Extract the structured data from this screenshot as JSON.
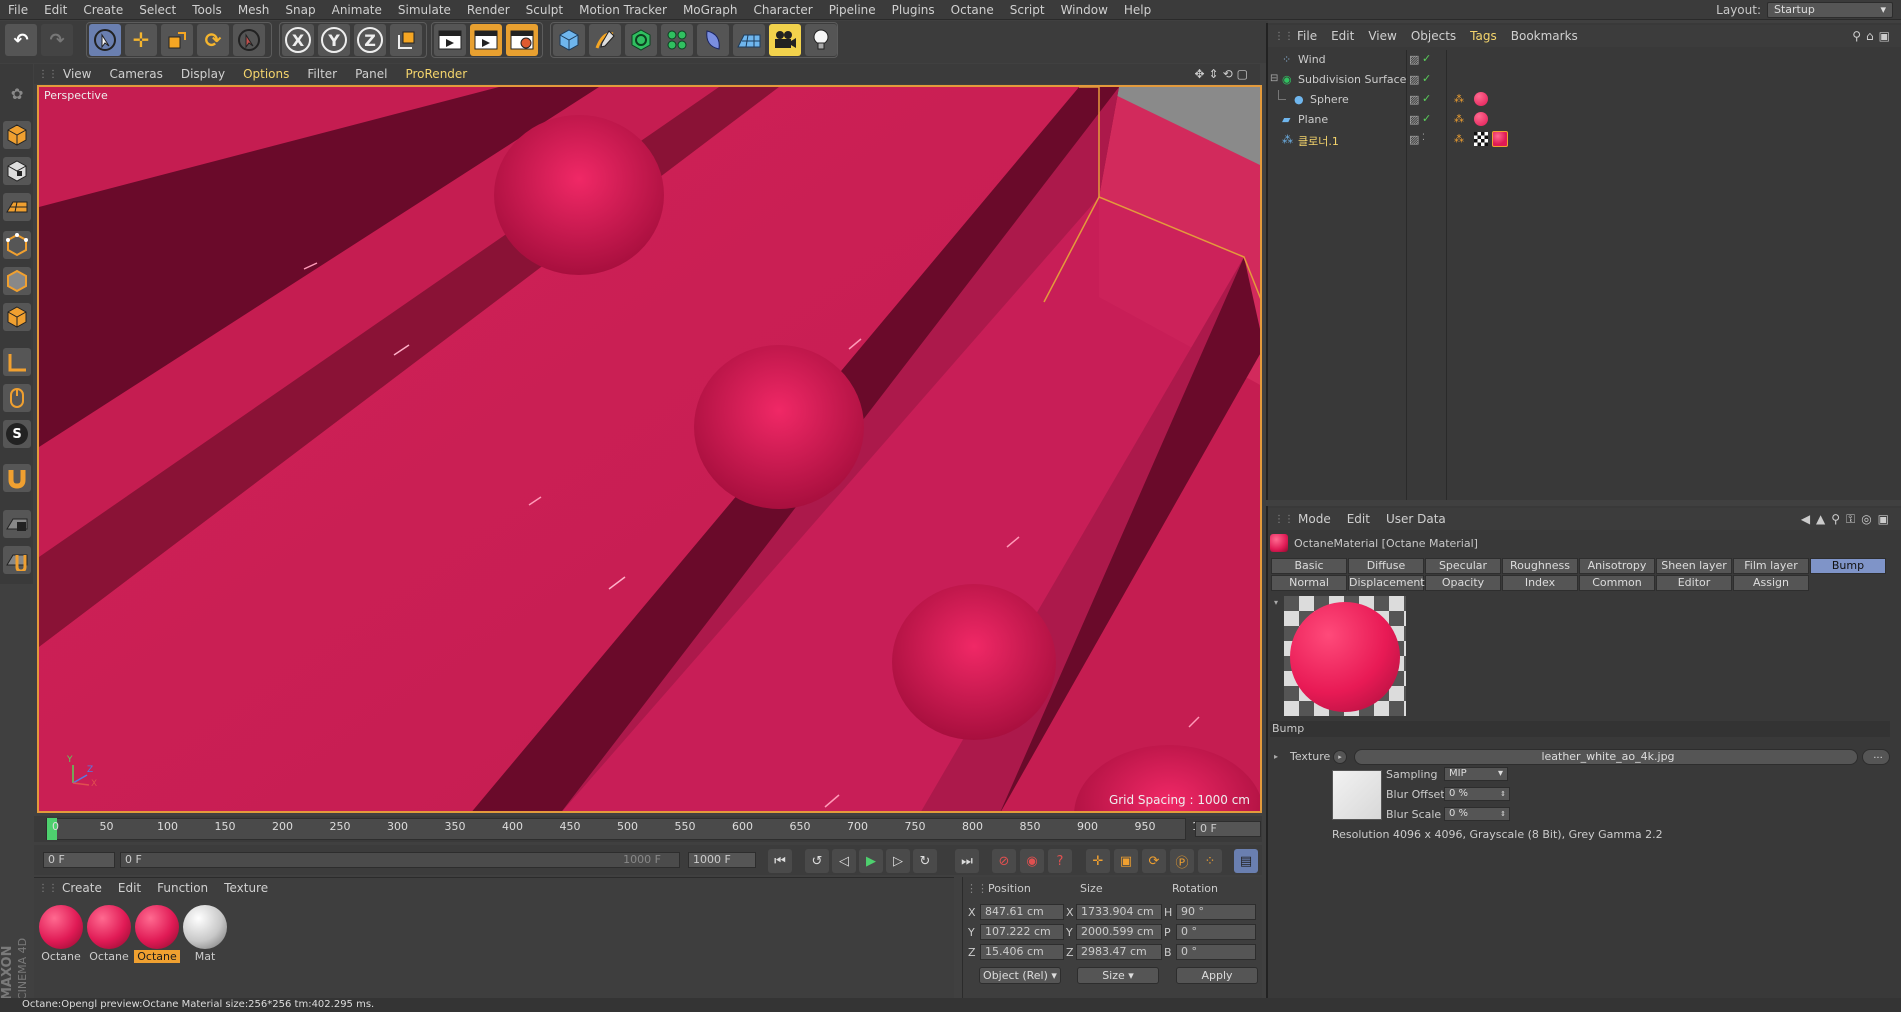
{
  "menu": {
    "items": [
      "File",
      "Edit",
      "Create",
      "Select",
      "Tools",
      "Mesh",
      "Snap",
      "Animate",
      "Simulate",
      "Render",
      "Sculpt",
      "Motion Tracker",
      "MoGraph",
      "Character",
      "Pipeline",
      "Plugins",
      "Octane",
      "Script",
      "Window",
      "Help"
    ],
    "layout_label": "Layout:",
    "layout_value": "Startup"
  },
  "toolbar": {
    "axis_x": "X",
    "axis_y": "Y",
    "axis_z": "Z"
  },
  "viewport": {
    "menu": [
      "View",
      "Cameras",
      "Display",
      "Options",
      "Filter",
      "Panel",
      "ProRender"
    ],
    "camera_label": "Perspective",
    "grid_spacing": "Grid Spacing : 1000 cm",
    "axis_y": "Y",
    "axis_z": "Z",
    "axis_x": "X"
  },
  "timeline": {
    "ticks": [
      "0",
      "50",
      "100",
      "150",
      "200",
      "250",
      "300",
      "350",
      "400",
      "450",
      "500",
      "550",
      "600",
      "650",
      "700",
      "750",
      "800",
      "850",
      "900",
      "950",
      "100"
    ],
    "current_frame": "0 F",
    "start_frame": "0 F",
    "range_start": "0 F",
    "range_end": "1000 F",
    "end_frame": "1000 F"
  },
  "materials": {
    "menu": [
      "Create",
      "Edit",
      "Function",
      "Texture"
    ],
    "items": [
      {
        "name": "Octane",
        "type": "red",
        "selected": false
      },
      {
        "name": "Octane",
        "type": "red",
        "selected": false
      },
      {
        "name": "Octane",
        "type": "red",
        "selected": true
      },
      {
        "name": "Mat",
        "type": "white",
        "selected": false
      }
    ]
  },
  "coords": {
    "position_label": "Position",
    "size_label": "Size",
    "rotation_label": "Rotation",
    "pos_x": "847.61 cm",
    "pos_y": "107.222 cm",
    "pos_z": "15.406 cm",
    "size_x": "1733.904 cm",
    "size_y": "2000.599 cm",
    "size_z": "2983.47 cm",
    "rot_h": "90 °",
    "rot_p": "0 °",
    "rot_b": "0 °",
    "axis_x": "X",
    "axis_y": "Y",
    "axis_z": "Z",
    "axis_h": "H",
    "axis_p": "P",
    "axis_b": "B",
    "mode_select": "Object (Rel)",
    "size_select": "Size",
    "apply_label": "Apply"
  },
  "objects": {
    "menu": [
      "File",
      "Edit",
      "View",
      "Objects",
      "Tags",
      "Bookmarks"
    ],
    "items": [
      {
        "name": "Wind",
        "indent": 0,
        "color": "#cccccc"
      },
      {
        "name": "Subdivision Surface",
        "indent": 0,
        "color": "#cccccc"
      },
      {
        "name": "Sphere",
        "indent": 1,
        "color": "#cccccc"
      },
      {
        "name": "Plane",
        "indent": 0,
        "color": "#cccccc"
      },
      {
        "name": "클로너.1",
        "indent": 0,
        "color": "#f4d46c"
      }
    ]
  },
  "attributes": {
    "menu": [
      "Mode",
      "Edit",
      "User Data"
    ],
    "title": "OctaneMaterial [Octane Material]",
    "tabs_row1": [
      "Basic",
      "Diffuse",
      "Specular",
      "Roughness",
      "Anisotropy",
      "Sheen layer",
      "Film layer",
      "Bump"
    ],
    "tabs_row2": [
      "Normal",
      "Displacement",
      "Opacity",
      "Index",
      "Common",
      "Editor",
      "Assign"
    ],
    "active_tab": "Bump",
    "section": "Bump",
    "texture_label": "Texture",
    "texture_file": "leather_white_ao_4k.jpg",
    "texture_more": "...",
    "sampling_label": "Sampling",
    "sampling_value": "MIP",
    "blur_offset_label": "Blur Offset",
    "blur_offset_value": "0 %",
    "blur_scale_label": "Blur Scale",
    "blur_scale_value": "0 %",
    "resolution": "Resolution 4096 x 4096, Grayscale (8 Bit), Grey Gamma 2.2"
  },
  "status": {
    "text": "Octane:Opengl preview:Octane Material  size:256*256  tm:402.295 ms."
  },
  "brand": {
    "maxon": "MAXON",
    "cinema": "CINEMA 4D"
  },
  "colors": {
    "accent_orange": "#f0a030",
    "selection_yellow": "#f4d46c",
    "bump_tab_blue": "#7f94c8",
    "viewport_red": "#c81e52"
  }
}
